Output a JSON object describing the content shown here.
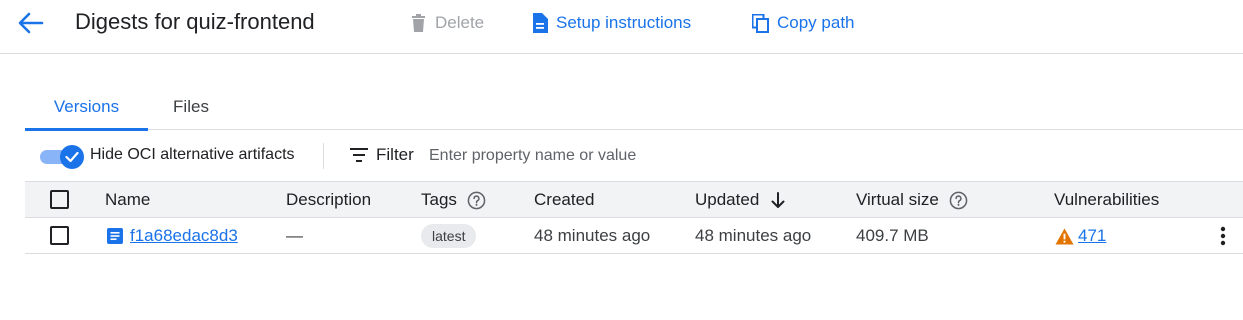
{
  "header": {
    "title": "Digests for quiz-frontend",
    "delete_label": "Delete",
    "setup_label": "Setup instructions",
    "copy_path_label": "Copy path"
  },
  "tabs": [
    {
      "label": "Versions",
      "active": true
    },
    {
      "label": "Files",
      "active": false
    }
  ],
  "toolbar": {
    "toggle_label": "Hide OCI alternative artifacts",
    "toggle_on": true,
    "filter_label": "Filter",
    "filter_placeholder": "Enter property name or value"
  },
  "table": {
    "columns": {
      "name": "Name",
      "description": "Description",
      "tags": "Tags",
      "created": "Created",
      "updated": "Updated",
      "virtual_size": "Virtual size",
      "vulnerabilities": "Vulnerabilities"
    },
    "sort_column": "Updated",
    "sort_direction": "descending",
    "rows": [
      {
        "name": "f1a68edac8d3",
        "description": "—",
        "tag": "latest",
        "created": "48 minutes ago",
        "updated": "48 minutes ago",
        "virtual_size": "409.7 MB",
        "vulnerabilities": "471"
      }
    ]
  },
  "colors": {
    "accent": "#1a73e8",
    "warning": "#e37400",
    "disabled": "#a0a4a8",
    "header_bg": "#f1f3f4"
  },
  "icons": [
    "arrow-back-icon",
    "trash-icon",
    "document-icon",
    "copy-icon",
    "filter-icon",
    "check-icon",
    "help-circle-icon",
    "arrow-down-icon",
    "artifact-icon",
    "warning-icon",
    "more-vert-icon"
  ]
}
